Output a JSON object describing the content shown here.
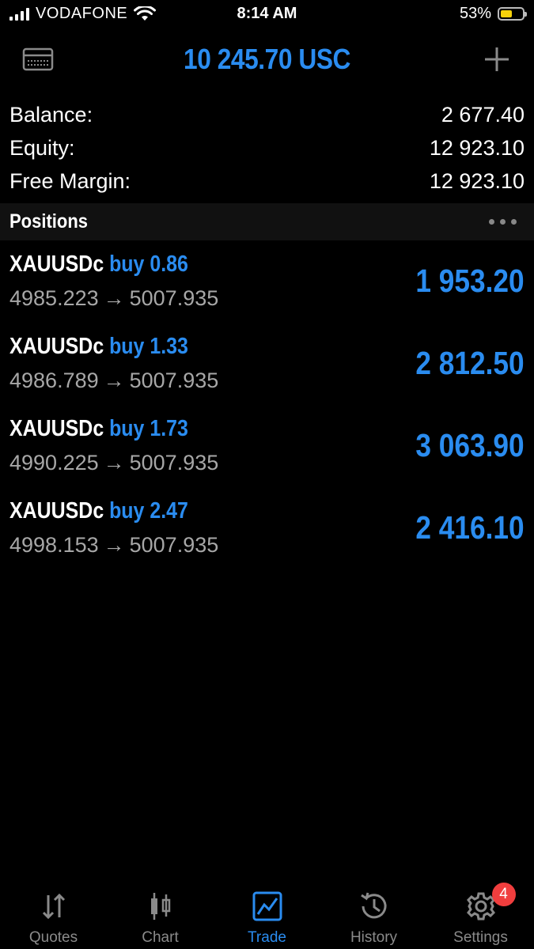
{
  "status_bar": {
    "carrier": "VODAFONE",
    "time": "8:14 AM",
    "battery_percent": "53%",
    "battery_level": 0.53,
    "battery_color": "#f5d10a"
  },
  "nav": {
    "left_icon": "card-icon",
    "title": "10 245.70 USC",
    "right_icon": "plus-icon",
    "accent_color": "#2a8cf0"
  },
  "summary": [
    {
      "label": "Balance:",
      "value": "2 677.40"
    },
    {
      "label": "Equity:",
      "value": "12 923.10"
    },
    {
      "label": "Free Margin:",
      "value": "12 923.10"
    }
  ],
  "positions_header": {
    "title": "Positions",
    "menu_icon": "more-dots-icon"
  },
  "positions": [
    {
      "symbol": "XAUUSDc",
      "side": "buy 0.86",
      "open_price": "4985.223",
      "arrow": "→",
      "current_price": "5007.935",
      "profit": "1 953.20"
    },
    {
      "symbol": "XAUUSDc",
      "side": "buy 1.33",
      "open_price": "4986.789",
      "arrow": "→",
      "current_price": "5007.935",
      "profit": "2 812.50"
    },
    {
      "symbol": "XAUUSDc",
      "side": "buy 1.73",
      "open_price": "4990.225",
      "arrow": "→",
      "current_price": "5007.935",
      "profit": "3 063.90"
    },
    {
      "symbol": "XAUUSDc",
      "side": "buy 2.47",
      "open_price": "4998.153",
      "arrow": "→",
      "current_price": "5007.935",
      "profit": "2 416.10"
    }
  ],
  "tabs": [
    {
      "label": "Quotes",
      "icon": "quotes-arrows-icon",
      "active": false
    },
    {
      "label": "Chart",
      "icon": "candlestick-chart-icon",
      "active": false
    },
    {
      "label": "Trade",
      "icon": "trade-line-chart-icon",
      "active": true
    },
    {
      "label": "History",
      "icon": "history-clock-icon",
      "active": false
    },
    {
      "label": "Settings",
      "icon": "gear-icon",
      "active": false,
      "badge": "4"
    }
  ]
}
